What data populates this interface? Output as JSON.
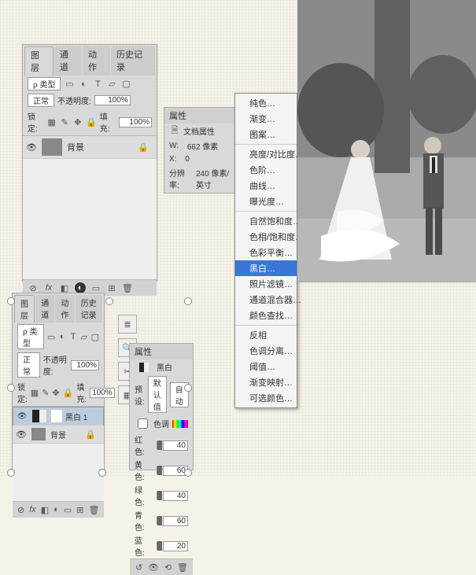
{
  "layers_panel": {
    "tabs": [
      "图层",
      "通道",
      "动作",
      "历史记录"
    ],
    "activeTab": 0,
    "kindLabel": "ρ 类型",
    "blendMode": "正常",
    "opacityLabel": "不透明度:",
    "opacity": "100%",
    "lockLabel": "锁定:",
    "fillLabel": "填充:",
    "fill": "100%",
    "layers": [
      {
        "name": "背景",
        "visible": true,
        "locked": true
      }
    ],
    "footerIcons": [
      "link-icon",
      "fx-icon",
      "mask-icon",
      "adjust-icon",
      "group-icon",
      "new-icon",
      "trash-icon"
    ]
  },
  "properties_panel": {
    "title": "属性",
    "docPropsLabel": "文档属性",
    "wLabel": "W:",
    "wValue": "662 像素",
    "xLabel": "X:",
    "xValue": "0",
    "resLabel": "分辨率:",
    "resValue": "240 像素/英寸"
  },
  "adjust_menu": {
    "items": [
      "纯色…",
      "渐变…",
      "图案…",
      "-",
      "亮度/对比度…",
      "色阶…",
      "曲线…",
      "曝光度…",
      "-",
      "自然饱和度…",
      "色相/饱和度…",
      "色彩平衡…",
      "黑白…",
      "照片滤镜…",
      "通道混合器…",
      "颜色查找…",
      "-",
      "反相",
      "色调分离…",
      "阈值…",
      "渐变映射…",
      "可选颜色…"
    ],
    "highlighted": "黑白…"
  },
  "layers_panel_2": {
    "tabs": [
      "图层",
      "通道",
      "动作",
      "历史记录"
    ],
    "activeTab": 0,
    "kindLabel": "ρ 类型",
    "blendMode": "正常",
    "opacityLabel": "不透明度:",
    "opacity": "100%",
    "lockLabel": "锁定:",
    "fillLabel": "填充:",
    "fill": "100%",
    "layers": [
      {
        "name": "黑白 1",
        "visible": true,
        "locked": false,
        "selected": true,
        "bw": true
      },
      {
        "name": "背景",
        "visible": true,
        "locked": true
      }
    ]
  },
  "bw_panel": {
    "title": "属性",
    "adjName": "黑白",
    "presetLabel": "预设:",
    "presetValue": "默认值",
    "autoLabel": "自动",
    "tintLabel": "色调",
    "sliders": [
      {
        "label": "红色:",
        "value": 40,
        "pos": 40
      },
      {
        "label": "黄色:",
        "value": 60,
        "pos": 60
      },
      {
        "label": "绿色:",
        "value": 40,
        "pos": 40
      },
      {
        "label": "青色:",
        "value": 60,
        "pos": 60
      },
      {
        "label": "蓝色:",
        "value": 20,
        "pos": 20
      }
    ]
  },
  "float_circles": [
    {
      "t": 378,
      "l": 134
    },
    {
      "t": 378,
      "l": 234
    },
    {
      "t": 488,
      "l": 234
    },
    {
      "t": 488,
      "l": 9
    },
    {
      "t": 378,
      "l": 9
    },
    {
      "t": 596,
      "l": 234
    },
    {
      "t": 596,
      "l": 9
    },
    {
      "t": 596,
      "l": 125
    }
  ]
}
